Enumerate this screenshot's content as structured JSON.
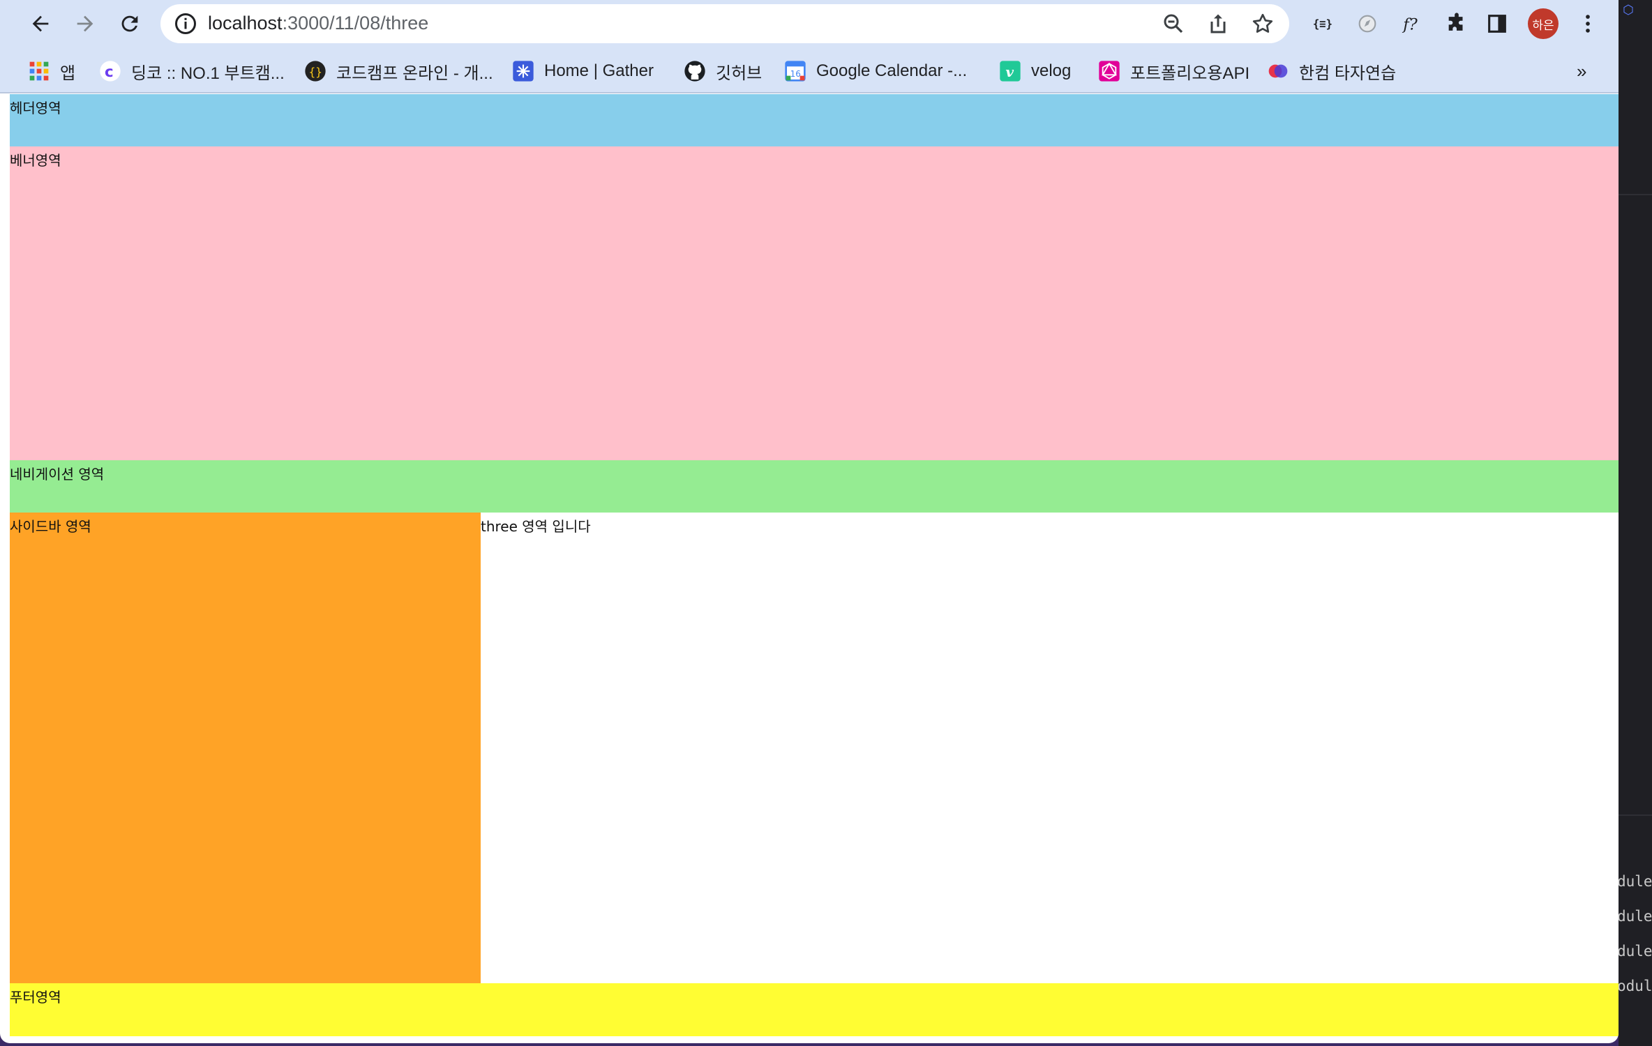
{
  "browser": {
    "url_host": "localhost",
    "url_path": ":3000/11/08/three",
    "profile_label": "하은",
    "accent": "#d7e3f7"
  },
  "bookmarks": [
    {
      "label": "앱",
      "icon": "apps-grid-icon"
    },
    {
      "label": "딩코 :: NO.1 부트캠...",
      "icon": "dingco-icon"
    },
    {
      "label": "코드캠프 온라인 - 개...",
      "icon": "codecamp-icon"
    },
    {
      "label": "Home | Gather",
      "icon": "gather-icon"
    },
    {
      "label": "깃허브",
      "icon": "github-icon"
    },
    {
      "label": "Google Calendar -...",
      "icon": "calendar-icon"
    },
    {
      "label": "velog",
      "icon": "velog-icon"
    },
    {
      "label": "포트폴리오용API",
      "icon": "graphql-icon"
    },
    {
      "label": "한컴 타자연습",
      "icon": "hancom-icon"
    }
  ],
  "bookmarks_overflow": "»",
  "page": {
    "header": "헤더영역",
    "banner": "베너영역",
    "navigation": "네비게이션 영역",
    "sidebar": "사이드바 영역",
    "main": "three 영역 입니다",
    "footer": "푸터영역"
  },
  "editor_fragments": [
    "dules",
    "dules",
    "dules",
    "odule"
  ]
}
